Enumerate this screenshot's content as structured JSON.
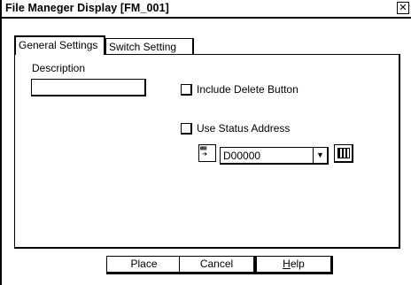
{
  "window": {
    "title": "File Maneger Display [FM_001]",
    "close_glyph": "✕"
  },
  "tabs": [
    {
      "label": "General Settings",
      "active": true
    },
    {
      "label": "Switch Setting",
      "active": false
    }
  ],
  "general": {
    "description_label": "Description",
    "description_value": "",
    "include_delete_label": "Include Delete Button",
    "include_delete_checked": false,
    "use_status_label": "Use Status Address",
    "use_status_checked": false,
    "status_address_value": "D00000",
    "address_icon": "device-address-icon",
    "keypad_icon": "keypad-icon"
  },
  "buttons": {
    "place": "Place",
    "cancel": "Cancel",
    "help_prefix": "H",
    "help_rest": "elp"
  }
}
